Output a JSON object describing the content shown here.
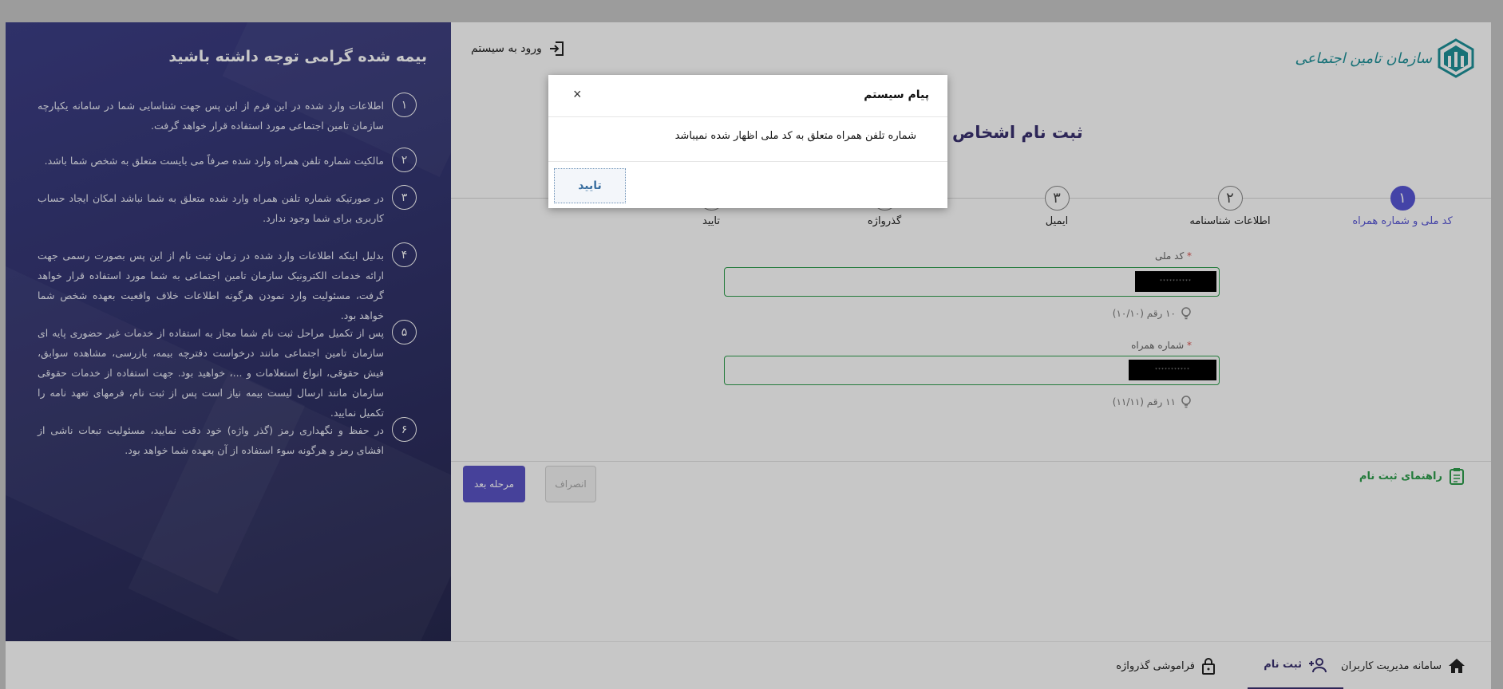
{
  "header": {
    "logo_text": "سازمان تامین اجتماعی",
    "login_label": "ورود به سیستم"
  },
  "main": {
    "page_title": "ثبت نام اشخاص",
    "steps": [
      {
        "number": "۱",
        "label": "کد ملی و شماره همراه",
        "active": true
      },
      {
        "number": "۲",
        "label": "اطلاعات شناسنامه"
      },
      {
        "number": "۳",
        "label": "ایمیل"
      },
      {
        "number": "",
        "label": "گذرواژه"
      },
      {
        "number": "",
        "label": "تایید"
      }
    ],
    "fields": {
      "national_code": {
        "label": "کد ملی",
        "required": "*",
        "value": "**********",
        "hint": "۱۰ رقم (۱۰/۱۰)"
      },
      "mobile": {
        "label": "شماره همراه",
        "required": "*",
        "value": "***********",
        "hint": "۱۱ رقم (۱۱/۱۱)"
      }
    },
    "next_label": "مرحله بعد",
    "cancel_label": "انصراف",
    "guide_label": "راهنمای ثبت نام"
  },
  "side_panel": {
    "title": "بیمه شده گرامی توجه داشته باشید",
    "notes": [
      {
        "num": "۱",
        "text": "اطلاعات وارد شده در این فرم از این پس جهت شناسایی شما در سامانه یکپارچه سازمان تامین اجتماعی مورد استفاده قرار خواهد گرفت."
      },
      {
        "num": "۲",
        "text": "مالکیت شماره تلفن همراه وارد شده صرفاً می بایست متعلق به شخص شما باشد."
      },
      {
        "num": "۳",
        "text": "در صورتیکه شماره تلفن همراه وارد شده متعلق به شما نباشد امکان ایجاد حساب کاربری برای شما وجود ندارد."
      },
      {
        "num": "۴",
        "text": "بدلیل اینکه اطلاعات وارد شده در زمان ثبت نام از این پس بصورت رسمی جهت ارائه خدمات الکترونیک سازمان تامین اجتماعی به شما مورد استفاده قرار خواهد گرفت، مسئولیت وارد نمودن هرگونه اطلاعات خلاف واقعیت بعهده شخص شما خواهد بود."
      },
      {
        "num": "۵",
        "text": "پس از تکمیل مراحل ثبت نام شما مجاز به استفاده از خدمات غیر حضوری پایه ای سازمان تامین اجتماعی مانند درخواست دفترچه بیمه، بازرسی، مشاهده سوابق، فیش حقوقی، انواع استعلامات و ...، خواهید بود. جهت استفاده از خدمات حقوقی سازمان مانند ارسال لیست بیمه نیاز است پس از ثبت نام، فرمهای تعهد نامه را تکمیل نمایید."
      },
      {
        "num": "۶",
        "text": "در حفظ و نگهداری رمز (گذر واژه) خود دقت نمایید، مسئولیت تبعات ناشی از افشای رمز و هرگونه سوء استفاده از آن بعهده شما خواهد بود."
      }
    ]
  },
  "bottom_nav": [
    {
      "label": "سامانه مدیریت کاربران",
      "icon": "home-icon"
    },
    {
      "label": "ثبت نام",
      "icon": "add-user-icon",
      "active": true
    },
    {
      "label": "فراموشی گذرواژه",
      "icon": "lock-icon"
    }
  ],
  "dialog": {
    "title": "پیام سیستم",
    "close": "×",
    "message": "شماره تلفن همراه متعلق به کد ملی اظهار شده نمیباشد",
    "ok_label": "تایید"
  },
  "colors": {
    "accent": "#5856d6",
    "brand_teal": "#1e9199",
    "success_green": "#2e9e4c",
    "sidebar_bg": "#3d3f87"
  }
}
